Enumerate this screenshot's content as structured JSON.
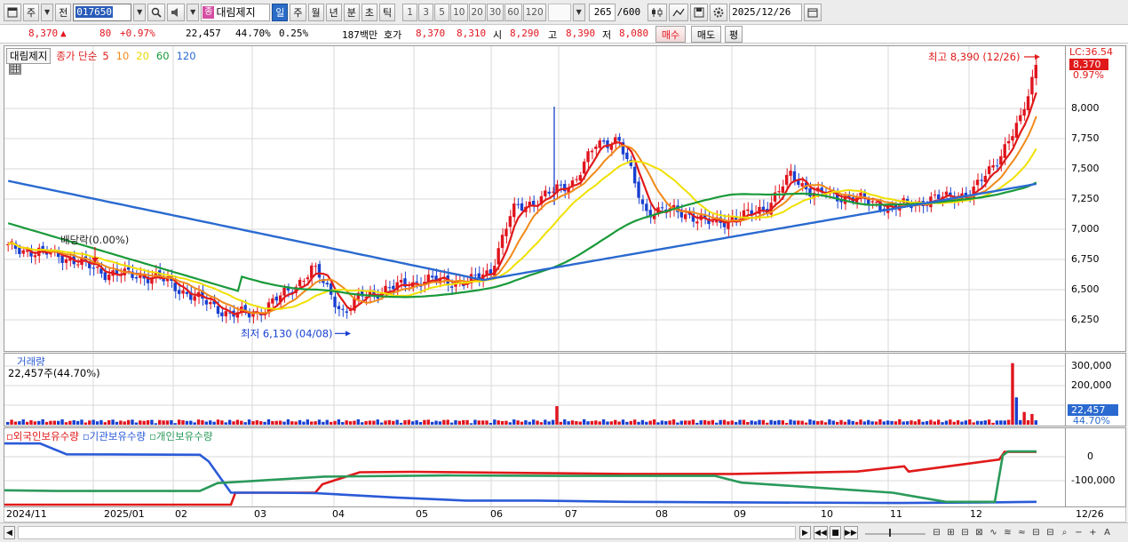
{
  "toolbar": {
    "period_label": "주",
    "prev_label": "전",
    "stock_code": "017650",
    "stock_badge": "종",
    "stock_name": "대림제지",
    "periods": [
      "일",
      "주",
      "월",
      "년",
      "분",
      "초",
      "틱"
    ],
    "active_period": "일",
    "multipliers": [
      "1",
      "3",
      "5",
      "10",
      "20",
      "30",
      "60",
      "120"
    ],
    "bar_count": "265",
    "bar_total": "/600",
    "date": "2025/12/26"
  },
  "quote": {
    "price": "8,370",
    "change_arrow": "▲",
    "change": "80",
    "change_pct": "+0.97%",
    "volume": "22,457",
    "volume_ratio": "44.70%",
    "turnover": "0.25%",
    "amount": "187백만",
    "bid_label": "호가",
    "ask": "8,370",
    "bid": "8,310",
    "open_label": "시",
    "open": "8,290",
    "high_label": "고",
    "high": "8,390",
    "low_label": "저",
    "low": "8,080",
    "buy_button": "매수",
    "sell_button": "매도",
    "avg_button": "평"
  },
  "price_panel": {
    "name_box": "대림제지",
    "ma_label": "종가 단순",
    "ma_periods": [
      {
        "label": "5",
        "color": "#e01a1a"
      },
      {
        "label": "10",
        "color": "#f08a1a"
      },
      {
        "label": "20",
        "color": "#e8d800"
      },
      {
        "label": "60",
        "color": "#1a9a3a"
      },
      {
        "label": "120",
        "color": "#2a6ad0"
      }
    ],
    "lc_label": "LC:36.54",
    "current_price_tag": "8,370",
    "current_pct_tag": "0.97%",
    "high_annotation": "최고 8,390 (12/26)",
    "low_annotation": "최저 6,130 (04/08)",
    "dividend_annotation": "배당락(0.00%)",
    "y_ticks": [
      "8,000",
      "7,750",
      "7,500",
      "7,250",
      "7,000",
      "6,750",
      "6,500",
      "6,250"
    ]
  },
  "volume_panel": {
    "title": "거래량",
    "subtitle": "22,457주(44.70%)",
    "y_ticks": [
      "300,000",
      "200,000"
    ],
    "current_tag": "22,457",
    "current_pct": "44.70%"
  },
  "holding_panel": {
    "series": [
      {
        "label": "외국인보유수량",
        "color": "#e01a1a"
      },
      {
        "label": "기관보유수량",
        "color": "#2a5ad8"
      },
      {
        "label": "개인보유수량",
        "color": "#2a9a5a"
      }
    ],
    "y_ticks": [
      "0",
      "-100,000"
    ]
  },
  "x_axis": {
    "labels": [
      "2024/11",
      "2025/01",
      "02",
      "03",
      "04",
      "05",
      "06",
      "07",
      "08",
      "09",
      "10",
      "11",
      "12"
    ],
    "last_label": "12/26"
  },
  "colors": {
    "up": "#e0141e",
    "down": "#1840d0",
    "grid": "#d8d8d8"
  },
  "chart_data": {
    "type": "candlestick",
    "x_range": [
      "2024/11",
      "2025/12/26"
    ],
    "y_range": [
      6130,
      8390
    ],
    "series": [
      {
        "name": "종가 단순 5",
        "type": "line"
      },
      {
        "name": "10",
        "type": "line"
      },
      {
        "name": "20",
        "type": "line"
      },
      {
        "name": "60",
        "type": "line"
      },
      {
        "name": "120",
        "type": "line"
      }
    ],
    "approx_close": [
      {
        "x": "2024/11",
        "y": 6850
      },
      {
        "x": "2025/01",
        "y": 6640
      },
      {
        "x": "02",
        "y": 6480
      },
      {
        "x": "03",
        "y": 6300
      },
      {
        "x": "04",
        "y": 6300
      },
      {
        "x": "05",
        "y": 6580
      },
      {
        "x": "06",
        "y": 6850
      },
      {
        "x": "07",
        "y": 7700
      },
      {
        "x": "08",
        "y": 7150
      },
      {
        "x": "09",
        "y": 7200
      },
      {
        "x": "10",
        "y": 7250
      },
      {
        "x": "11",
        "y": 7180
      },
      {
        "x": "12",
        "y": 7400
      },
      {
        "x": "12/26",
        "y": 8370
      }
    ],
    "high": {
      "value": 8390,
      "date": "12/26"
    },
    "low": {
      "value": 6130,
      "date": "04/08"
    }
  }
}
